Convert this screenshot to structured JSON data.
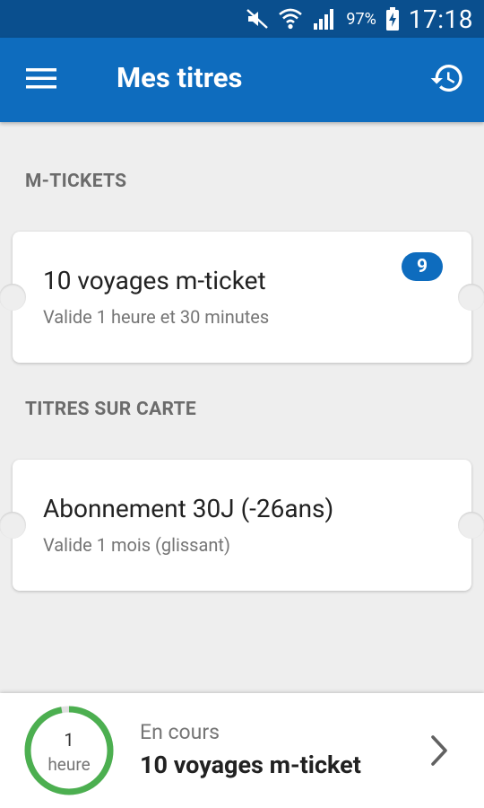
{
  "status_bar": {
    "battery_percent": "97%",
    "time": "17:18",
    "icons": [
      "mute-icon",
      "wifi-icon",
      "signal-icon",
      "battery-charging-icon"
    ]
  },
  "app_bar": {
    "title": "Mes titres",
    "menu_icon": "hamburger-menu-icon",
    "history_icon": "history-icon"
  },
  "sections": {
    "mtickets": {
      "heading": "M-TICKETS",
      "card": {
        "title": "10 voyages m-ticket",
        "subtitle": "Valide 1 heure et 30 minutes",
        "badge_count": "9"
      }
    },
    "card_titles": {
      "heading": "TITRES SUR CARTE",
      "card": {
        "title": "Abonnement 30J (-26ans)",
        "subtitle": "Valide 1 mois (glissant)"
      }
    }
  },
  "bottom_panel": {
    "timer_value": "1",
    "timer_unit": "heure",
    "timer_progress": 0.97,
    "label": "En cours",
    "title": "10 voyages m-ticket",
    "chevron_icon": "chevron-right-icon"
  },
  "colors": {
    "status_bar": "#0A4F8E",
    "app_bar": "#0E6CBE",
    "background": "#EEEEEE",
    "badge": "#0E6CBE",
    "timer_ring": "#4CAF50"
  }
}
